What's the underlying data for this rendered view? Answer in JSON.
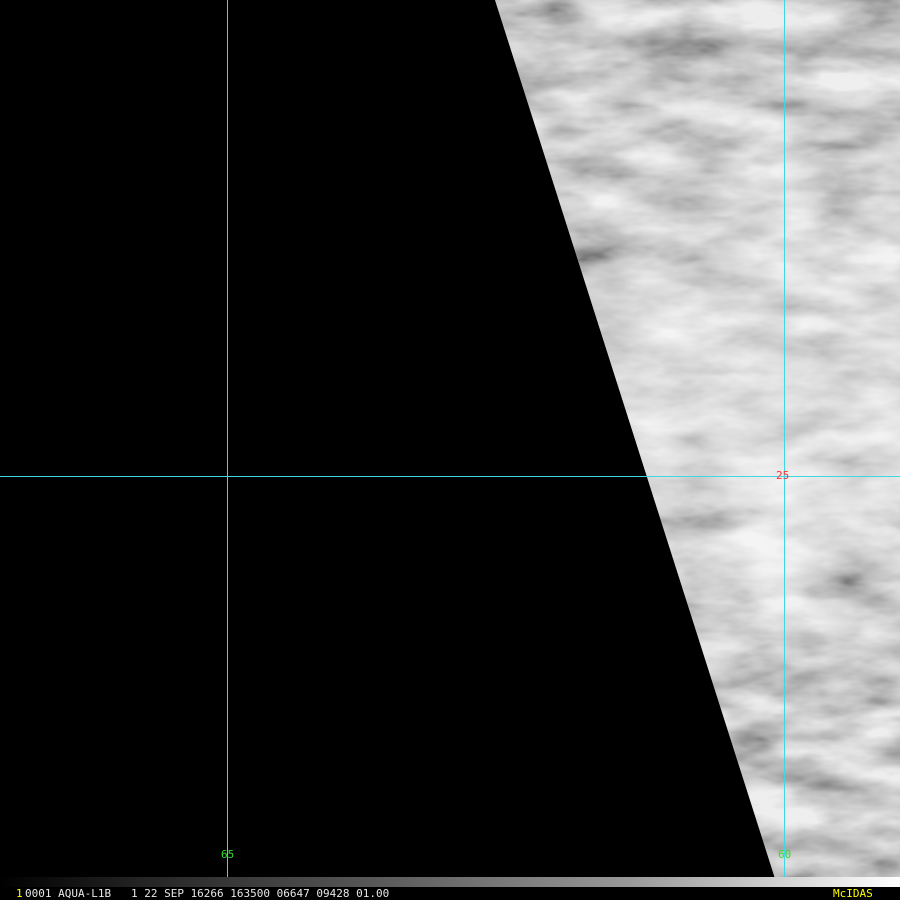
{
  "colors": {
    "background": "#000000",
    "grid_line": "#3fd6e6",
    "latitude_label": "#ff3030",
    "longitude_label": "#33dd33",
    "frame_number": "#ffff00",
    "status_text": "#e8e8e8",
    "brand": "#ffff00"
  },
  "latitude_labels": [
    "25"
  ],
  "longitude_labels": [
    "65",
    "60"
  ],
  "status_bar": {
    "frame_number": "1",
    "info": "0001 AQUA-L1B   1 22 SEP 16266 163500 06647 09428 01.00",
    "brand": "McIDAS"
  }
}
